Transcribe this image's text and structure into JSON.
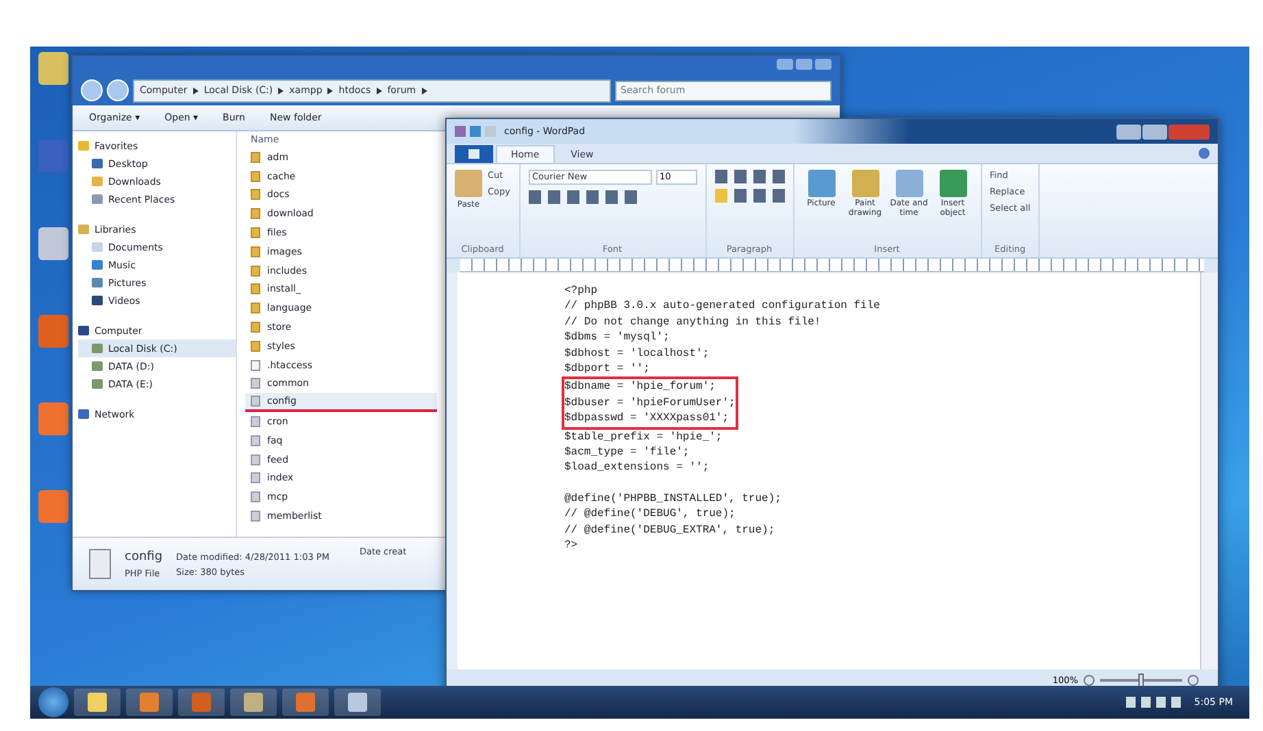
{
  "explorer": {
    "breadcrumb": [
      "Computer",
      "Local Disk (C:)",
      "xampp",
      "htdocs",
      "forum"
    ],
    "search": {
      "placeholder": "Search forum"
    },
    "toolbar": [
      "Organize ▾",
      "Open ▾",
      "Burn",
      "New folder"
    ],
    "nav": [
      {
        "label": "Favorites",
        "kind": "star",
        "selected": false,
        "children": [
          {
            "label": "Desktop",
            "kind": "desktop",
            "selected": false
          },
          {
            "label": "Downloads",
            "kind": "folder",
            "selected": false
          },
          {
            "label": "Recent Places",
            "kind": "recent",
            "selected": false
          }
        ]
      },
      {
        "label": "Libraries",
        "kind": "library",
        "selected": false,
        "children": [
          {
            "label": "Documents",
            "kind": "doc",
            "selected": false
          },
          {
            "label": "Music",
            "kind": "music",
            "selected": false
          },
          {
            "label": "Pictures",
            "kind": "picture",
            "selected": false
          },
          {
            "label": "Videos",
            "kind": "video",
            "selected": false
          }
        ]
      },
      {
        "label": "Computer",
        "kind": "computer",
        "selected": false,
        "children": [
          {
            "label": "Local Disk (C:)",
            "kind": "drive",
            "selected": true
          },
          {
            "label": "DATA (D:)",
            "kind": "drive",
            "selected": false
          },
          {
            "label": "DATA (E:)",
            "kind": "drive",
            "selected": false
          }
        ]
      },
      {
        "label": "Network",
        "kind": "network",
        "selected": false
      }
    ],
    "column": "Name",
    "files": [
      {
        "name": "adm",
        "kind": "folder",
        "selected": false,
        "underlined": false
      },
      {
        "name": "cache",
        "kind": "folder",
        "selected": false,
        "underlined": false
      },
      {
        "name": "docs",
        "kind": "folder",
        "selected": false,
        "underlined": false
      },
      {
        "name": "download",
        "kind": "folder",
        "selected": false,
        "underlined": false
      },
      {
        "name": "files",
        "kind": "folder",
        "selected": false,
        "underlined": false
      },
      {
        "name": "images",
        "kind": "folder",
        "selected": false,
        "underlined": false
      },
      {
        "name": "includes",
        "kind": "folder",
        "selected": false,
        "underlined": false
      },
      {
        "name": "install_",
        "kind": "folder",
        "selected": false,
        "underlined": false
      },
      {
        "name": "language",
        "kind": "folder",
        "selected": false,
        "underlined": false
      },
      {
        "name": "store",
        "kind": "folder",
        "selected": false,
        "underlined": false
      },
      {
        "name": "styles",
        "kind": "folder",
        "selected": false,
        "underlined": false
      },
      {
        "name": ".htaccess",
        "kind": "blank",
        "selected": false,
        "underlined": false
      },
      {
        "name": "common",
        "kind": "file",
        "selected": false,
        "underlined": false
      },
      {
        "name": "config",
        "kind": "file",
        "selected": true,
        "underlined": true
      },
      {
        "name": "cron",
        "kind": "file",
        "selected": false,
        "underlined": false
      },
      {
        "name": "faq",
        "kind": "file",
        "selected": false,
        "underlined": false
      },
      {
        "name": "feed",
        "kind": "file",
        "selected": false,
        "underlined": false
      },
      {
        "name": "index",
        "kind": "file",
        "selected": false,
        "underlined": false
      },
      {
        "name": "mcp",
        "kind": "file",
        "selected": false,
        "underlined": false
      },
      {
        "name": "memberlist",
        "kind": "file",
        "selected": false,
        "underlined": false
      }
    ],
    "details": {
      "name": "config",
      "type": "PHP File",
      "modified": "Date modified: 4/28/2011 1:03 PM",
      "size": "Size: 380 bytes",
      "created": "Date creat"
    }
  },
  "wordpad": {
    "title": "config - WordPad",
    "tabs": [
      {
        "label": "Home",
        "selected": true
      },
      {
        "label": "View",
        "selected": false
      }
    ],
    "clipboard": {
      "paste": "Paste",
      "cut": "Cut",
      "copy": "Copy",
      "label": "Clipboard"
    },
    "font": {
      "family": "Courier New",
      "size": "10",
      "label": "Font"
    },
    "paragraph": {
      "label": "Paragraph"
    },
    "insert": {
      "items": [
        "Picture",
        "Paint drawing",
        "Date and time",
        "Insert object"
      ],
      "label": "Insert"
    },
    "editing": {
      "items": [
        "Find",
        "Replace",
        "Select all"
      ],
      "label": "Editing"
    },
    "paragraphs": [
      [
        {
          "text": "<?php",
          "boxed": false
        },
        {
          "text": "// phpBB 3.0.x auto-generated configuration file",
          "boxed": false
        },
        {
          "text": "// Do not change anything in this file!",
          "boxed": false
        },
        {
          "text": "$dbms = 'mysql';",
          "boxed": false
        },
        {
          "text": "$dbhost = 'localhost';",
          "boxed": false
        },
        {
          "text": "$dbport = '';",
          "boxed": false
        },
        {
          "text": "$dbname = 'hpie_forum';",
          "boxed": true
        },
        {
          "text": "$dbuser = 'hpieForumUser';",
          "boxed": true
        },
        {
          "text": "$dbpasswd = 'XXXXpass01';",
          "boxed": true
        },
        {
          "text": "$table_prefix = 'hpie_';",
          "boxed": false
        },
        {
          "text": "$acm_type = 'file';",
          "boxed": false
        },
        {
          "text": "$load_extensions = '';",
          "boxed": false
        }
      ],
      [
        {
          "text": "@define('PHPBB_INSTALLED', true);",
          "boxed": false
        },
        {
          "text": "// @define('DEBUG', true);",
          "boxed": false
        },
        {
          "text": "// @define('DEBUG_EXTRA', true);",
          "boxed": false
        },
        {
          "text": "?>",
          "boxed": false
        }
      ]
    ],
    "zoom": "100%",
    "zoom_slider": {
      "level": 0.5
    }
  },
  "taskbar": {
    "clock": "5:05 PM"
  }
}
